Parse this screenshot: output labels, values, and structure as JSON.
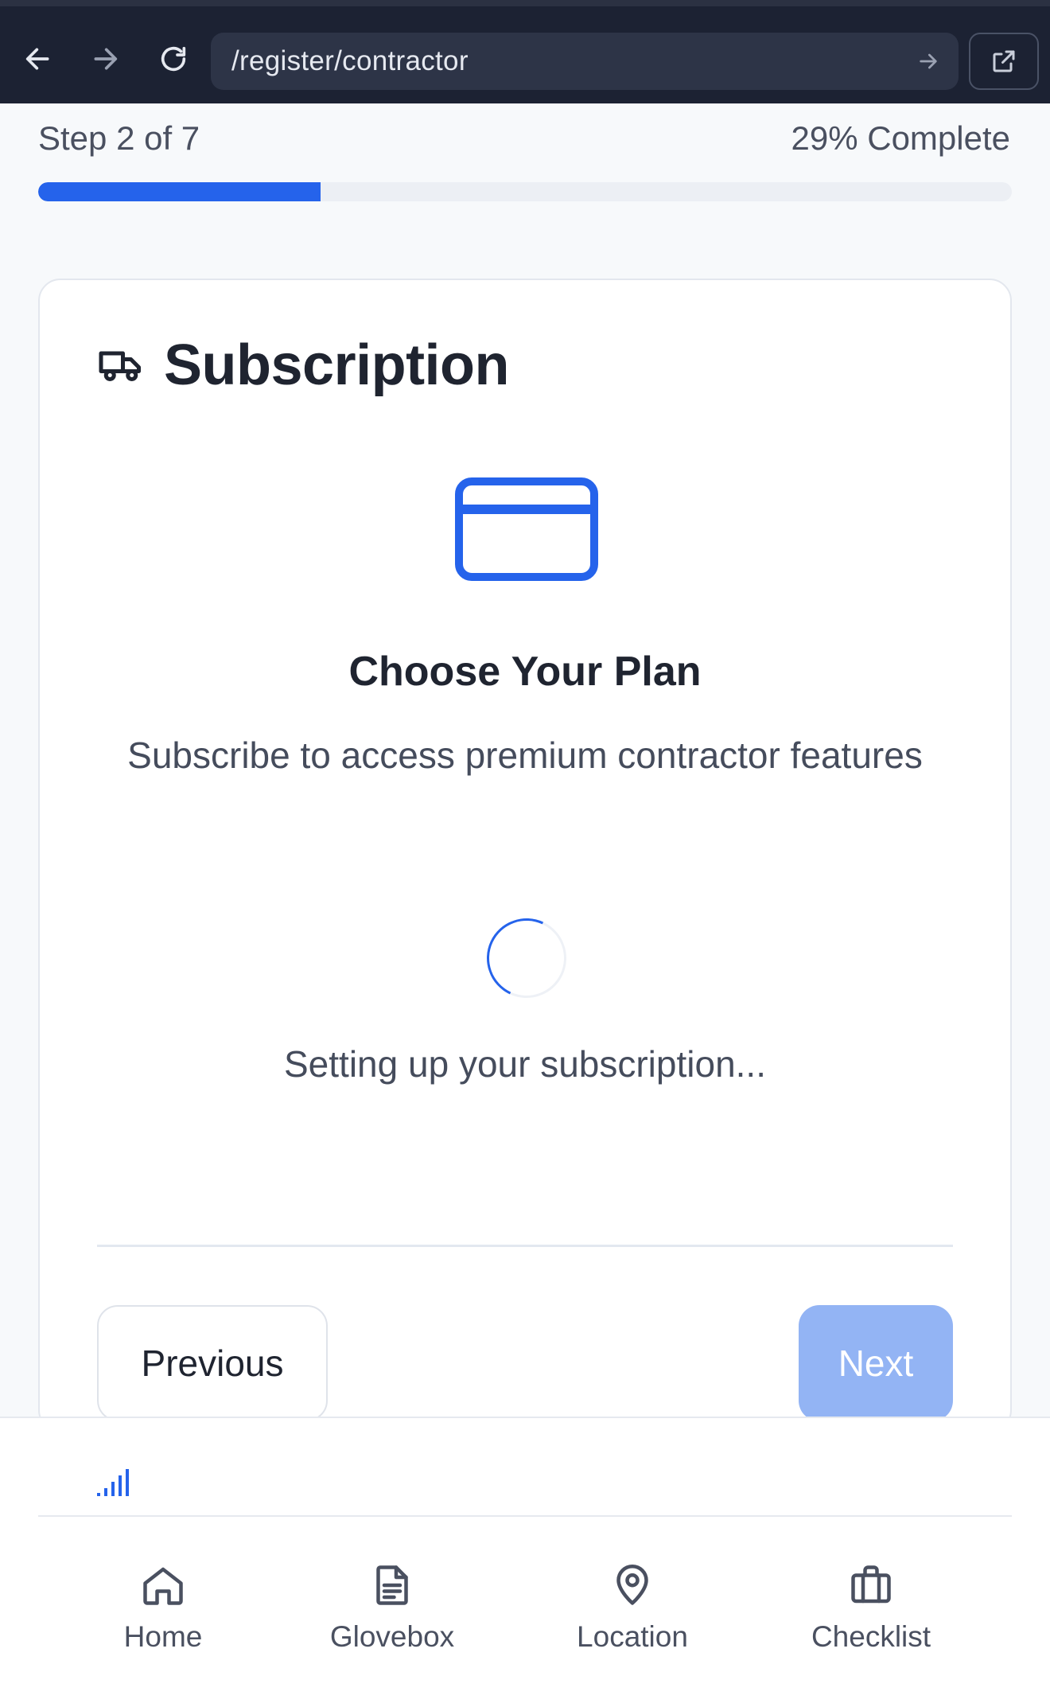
{
  "browser": {
    "url": "/register/contractor",
    "colors": {
      "bar": "#1c2233",
      "urlbar": "#2d3447"
    }
  },
  "progress": {
    "step_label": "Step 2 of 7",
    "percent_label": "29% Complete",
    "percent": 29,
    "color": "#2563eb"
  },
  "card": {
    "title": "Subscription",
    "title_icon": "truck-icon",
    "hero_icon": "credit-card-icon",
    "heading": "Choose Your Plan",
    "subheading": "Subscribe to access premium contractor features",
    "loading_text": "Setting up your subscription...",
    "buttons": {
      "previous": "Previous",
      "next": "Next"
    }
  },
  "status_icon": "signal-bars-icon",
  "bottom_nav": {
    "items": [
      {
        "label": "Home",
        "icon": "home-icon"
      },
      {
        "label": "Glovebox",
        "icon": "document-icon"
      },
      {
        "label": "Location",
        "icon": "map-pin-icon"
      },
      {
        "label": "Checklist",
        "icon": "briefcase-icon"
      }
    ]
  }
}
